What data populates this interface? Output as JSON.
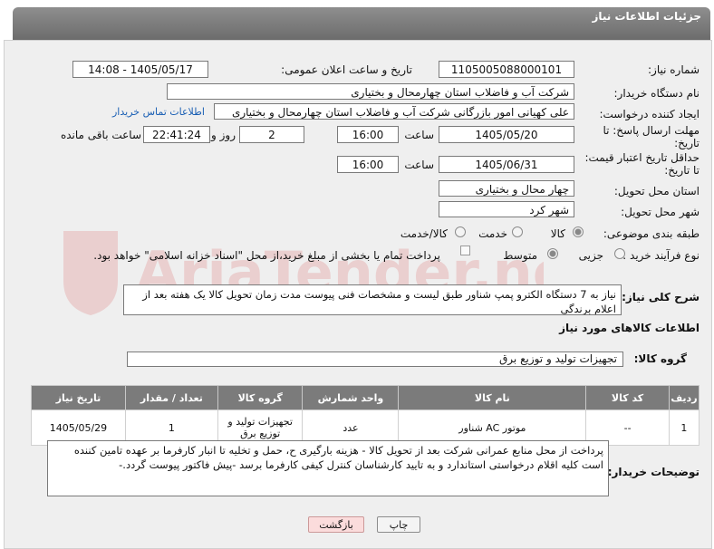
{
  "header": {
    "title": "جزئیات اطلاعات نیاز"
  },
  "form": {
    "need_number": {
      "label": "شماره نیاز:",
      "value": "1105005088000101"
    },
    "announce_datetime": {
      "label": "تاریخ و ساعت اعلان عمومی:",
      "value": "1405/05/17 - 14:08"
    },
    "buyer_org": {
      "label": "نام دستگاه خریدار:",
      "value": "شرکت آب و فاضلاب استان چهارمحال و بختیاری"
    },
    "requester": {
      "label": "ایجاد کننده درخواست:",
      "value": "علی کهیانی امور بازرگانی شرکت آب و فاضلاب استان چهارمحال و بختیاری",
      "contact_link": "اطلاعات تماس خریدار"
    },
    "reply_deadline": {
      "label_line1": "مهلت ارسال پاسخ: تا",
      "label_line2": "تاریخ:",
      "date": "1405/05/20",
      "time_label": "ساعت",
      "time": "16:00",
      "days": "2",
      "days_label": "روز و",
      "remaining": "22:41:24",
      "remaining_label": "ساعت باقی مانده"
    },
    "price_deadline": {
      "label_line1": "حداقل تاریخ اعتبار قیمت:",
      "label_line2": "تا تاریخ:",
      "date": "1405/06/31",
      "time_label": "ساعت",
      "time": "16:00"
    },
    "province": {
      "label": "استان محل تحویل:",
      "value": "چهار محال و بختیاری"
    },
    "city": {
      "label": "شهر محل تحویل:",
      "value": "شهر کرد"
    },
    "category": {
      "label": "طبقه بندی موضوعی:",
      "options": [
        "کالا",
        "خدمت",
        "کالا/خدمت"
      ],
      "selected": "کالا"
    },
    "process": {
      "label": "نوع فرآیند خرید :",
      "options": [
        "جزیی",
        "متوسط"
      ],
      "selected": "متوسط",
      "payment_note": "پرداخت تمام یا بخشی از مبلغ خرید،از محل \"اسناد خزانه اسلامی\" خواهد بود."
    },
    "description": {
      "label": "شرح کلی نیاز:",
      "value": "نیاز به 7 دستگاه الکترو پمپ شناور طبق لیست و مشخصات فنی پیوست مدت زمان تحویل کالا یک هفته بعد از اعلام برندگی"
    },
    "items_title": "اطلاعات کالاهای مورد نیاز",
    "goods_group": {
      "label": "گروه کالا:",
      "value": "تجهیزات تولید و توزیع برق"
    }
  },
  "table": {
    "headers": [
      "ردیف",
      "کد کالا",
      "نام کالا",
      "واحد شمارش",
      "گروه کالا",
      "تعداد / مقدار",
      "تاریخ نیاز"
    ],
    "rows": [
      [
        "1",
        "--",
        "موتور AC شناور",
        "عدد",
        "تجهیزات تولید و توزیع برق",
        "1",
        "1405/05/29"
      ]
    ]
  },
  "buyer_notes": {
    "label": "توضیحات خریدار:",
    "value": "پرداخت از محل منابع عمرانی شرکت بعد از تحویل کالا   - هزینه بارگیری ح، حمل و تخلیه تا انبار کارفرما بر عهده تامین کننده است کلیه اقلام درخواستی استاندارد و به تایید کارشناسان کنترل کیفی کارفرما برسد -پیش فاکتور پیوست گردد.-"
  },
  "buttons": {
    "print": "چاپ",
    "back": "بازگشت"
  },
  "watermark": {
    "text": "AriaTender.neT"
  }
}
